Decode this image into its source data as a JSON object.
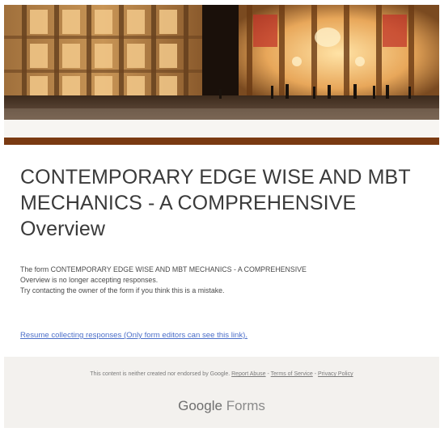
{
  "form": {
    "title": "CONTEMPORARY EDGE WISE AND MBT MECHANICS - A COMPREHENSIVE Overview",
    "closed_message_line1": "The form CONTEMPORARY EDGE WISE AND MBT MECHANICS - A COMPREHENSIVE",
    "closed_message_line2": "Overview is no longer accepting responses.",
    "closed_message_line3": "Try contacting the owner of the form if you think this is a mistake.",
    "resume_link": "Resume collecting responses (Only form editors can see this link)."
  },
  "footer": {
    "disclaimer": "This content is neither created nor endorsed by Google.",
    "report_abuse": "Report Abuse",
    "separator": " - ",
    "terms": "Terms of Service",
    "privacy": "Privacy Policy",
    "brand_google": "Google",
    "brand_product": "Forms"
  },
  "header_image": {
    "icon": "theater-photo",
    "description_visible": false
  },
  "colors": {
    "accent_bar": "#7a3a12",
    "link": "#4c6fc9",
    "title_text": "#3a3a3a",
    "footer_bg": "#f3f1ee"
  }
}
